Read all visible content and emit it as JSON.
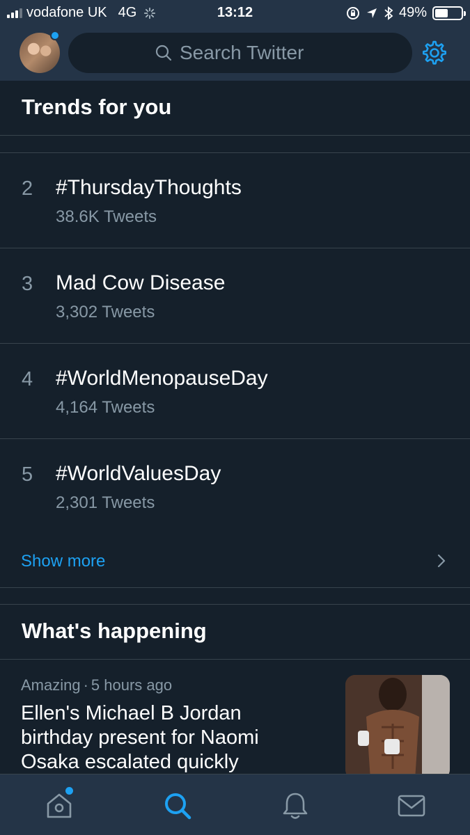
{
  "status_bar": {
    "carrier": "vodafone UK",
    "network": "4G",
    "time": "13:12",
    "battery_percent": "49%",
    "battery_level": 0.49,
    "signal_bars_filled": 3
  },
  "search": {
    "placeholder": "Search Twitter"
  },
  "trends_section": {
    "title": "Trends for you",
    "items": [
      {
        "rank": "2",
        "name": "#ThursdayThoughts",
        "count": "38.6K Tweets"
      },
      {
        "rank": "3",
        "name": "Mad Cow Disease",
        "count": "3,302 Tweets"
      },
      {
        "rank": "4",
        "name": "#WorldMenopauseDay",
        "count": "4,164 Tweets"
      },
      {
        "rank": "5",
        "name": "#WorldValuesDay",
        "count": "2,301 Tweets"
      }
    ],
    "show_more_label": "Show more"
  },
  "happening_section": {
    "title": "What's happening",
    "story": {
      "category": "Amazing",
      "separator": "·",
      "time": "5 hours ago",
      "headline": "Ellen's Michael B Jordan birthday present for Naomi Osaka escalated quickly"
    }
  },
  "icons": {
    "home": "home-icon",
    "search": "search-icon",
    "notifications": "bell-icon",
    "messages": "envelope-icon",
    "settings": "gear-icon"
  },
  "colors": {
    "background": "#15202b",
    "bar": "#243447",
    "accent": "#1da1f2",
    "secondary_text": "#8899a6",
    "divider": "#38444d"
  }
}
